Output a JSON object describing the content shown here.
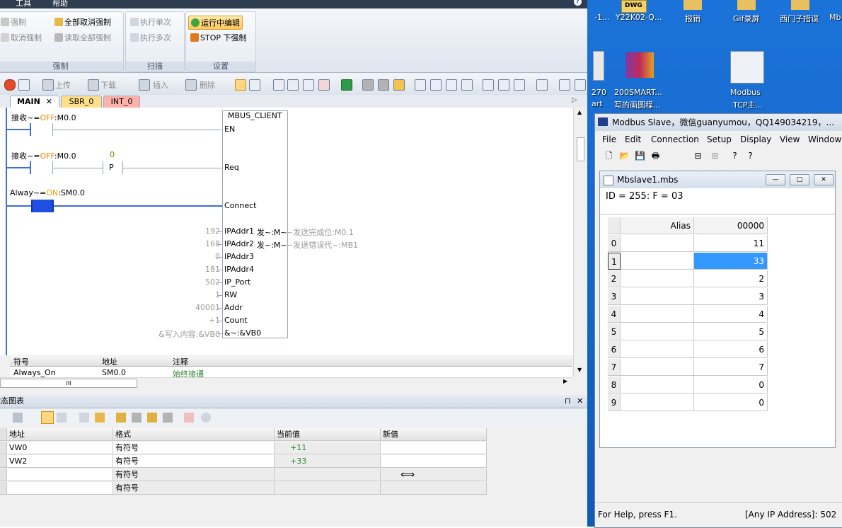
{
  "left_app": {
    "menu": [
      "工具",
      "帮助"
    ],
    "ribbon": {
      "force_group": {
        "title": "强制",
        "items": [
          "强制",
          "取消强制",
          "全部取消强制",
          "读取全部强制"
        ]
      },
      "scan_group": {
        "title": "扫描",
        "items": [
          "执行单次",
          "执行多次"
        ]
      },
      "setting_group": {
        "title": "设置",
        "items": [
          "运行中编辑",
          "STOP 下强制"
        ]
      }
    },
    "toolbar": {
      "upload": "上传",
      "download": "下载",
      "insert": "插入",
      "delete": "删除"
    },
    "tabs": [
      "MAIN",
      "SBR_0",
      "INT_0"
    ],
    "ladder": {
      "rung1_contact": {
        "name": "接收~",
        "eq": "=",
        "state": "OFF",
        "addr": ":M0.0"
      },
      "rung2_contact": {
        "name": "接收~",
        "eq": "=",
        "state": "OFF",
        "addr": ":M0.0",
        "value": "0",
        "p": "P"
      },
      "rung3_contact": {
        "name": "Alway~",
        "eq": "=",
        "state": "ON",
        "addr": ":SM0.0"
      },
      "block": {
        "name": "MBUS_CLIENT",
        "pins": [
          "EN",
          "Req",
          "Connect",
          "IPAddr1",
          "IPAddr2",
          "IPAddr3",
          "IPAddr4",
          "IP_Port",
          "RW",
          "Addr",
          "Count",
          "&~:&VB0"
        ],
        "values": [
          "192",
          "168",
          "0",
          "181",
          "502",
          "1",
          "40001",
          "+1",
          "&写入内容:&VB0"
        ],
        "out1": "发~:M~",
        "out1_comment": "~发送完成位:M0.1",
        "out2": "发~:M~",
        "out2_comment": "~发送错误代~:MB1"
      }
    },
    "symbol_table": {
      "headers": [
        "符号",
        "地址",
        "注释"
      ],
      "row": [
        "Always_On",
        "SM0.0",
        "始终接通"
      ]
    },
    "hscroll_grip": "III",
    "status_chart": {
      "title": "状态图表",
      "headers": [
        "地址",
        "格式",
        "当前值",
        "新值"
      ],
      "rows": [
        [
          "VW0",
          "有符号",
          "+11",
          ""
        ],
        [
          "VW2",
          "有符号",
          "+33",
          ""
        ],
        [
          "",
          "有符号",
          "",
          ""
        ],
        [
          "",
          "有符号",
          "",
          ""
        ]
      ]
    }
  },
  "desktop": {
    "icons": [
      {
        "label": "-1..."
      },
      {
        "label": "Y22K02-Q...",
        "badge": "DWG"
      },
      {
        "label": "报销"
      },
      {
        "label": "Gif录屏"
      },
      {
        "label": "西门子措误"
      },
      {
        "label": "Mb"
      },
      {
        "label": "270"
      },
      {
        "label": "art"
      },
      {
        "label": "200SMART..."
      },
      {
        "label": "写的画圆程..."
      },
      {
        "label": "Modbus"
      },
      {
        "label": "TCP主..."
      }
    ]
  },
  "modbus": {
    "title": "Modbus Slave，微信guanyumou，QQ149034219，...",
    "menu": [
      "File",
      "Edit",
      "Connection",
      "Setup",
      "Display",
      "View",
      "Window"
    ],
    "child": {
      "title": "Mbslave1.mbs",
      "header": "ID = 255: F = 03",
      "col_alias": "Alias",
      "col_addr": "00000",
      "rows": [
        {
          "idx": "0",
          "value": "11"
        },
        {
          "idx": "1",
          "value": "33"
        },
        {
          "idx": "2",
          "value": "2"
        },
        {
          "idx": "3",
          "value": "3"
        },
        {
          "idx": "4",
          "value": "4"
        },
        {
          "idx": "5",
          "value": "5"
        },
        {
          "idx": "6",
          "value": "6"
        },
        {
          "idx": "7",
          "value": "7"
        },
        {
          "idx": "8",
          "value": "0"
        },
        {
          "idx": "9",
          "value": "0"
        }
      ],
      "selected_row": 1
    },
    "status_left": "For Help, press F1.",
    "status_right": "[Any IP Address]: 502"
  },
  "colors": {
    "accent_blue": "#3b6fd9",
    "selected_cell": "#3399ff",
    "off_state": "#e08a00",
    "on_state": "#e0a000",
    "comment_green": "#2a8a2a"
  }
}
